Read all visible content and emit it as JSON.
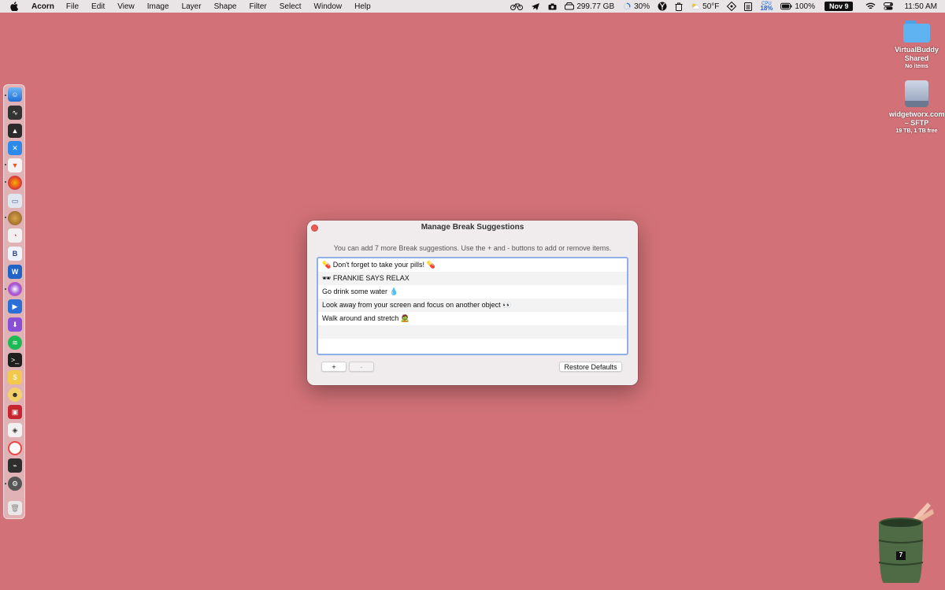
{
  "menubar": {
    "apple_icon": "apple-icon",
    "app_name": "Acorn",
    "menus": [
      "File",
      "Edit",
      "View",
      "Image",
      "Layer",
      "Shape",
      "Filter",
      "Select",
      "Window",
      "Help"
    ],
    "status": {
      "disk": "299.77 GB",
      "progress": "30%",
      "weather": "50°F",
      "cpu_label": "CPU",
      "cpu_value": "18%",
      "battery": "100%",
      "date": "Nov 9",
      "time": "11:50 AM"
    }
  },
  "desktop": {
    "folder": {
      "label": "VirtualBuddy Shared",
      "sub": "No items"
    },
    "drive": {
      "label": "widgetworx.com – SFTP",
      "sub": "19 TB, 1 TB free"
    },
    "trash_badge": "7"
  },
  "dialog": {
    "title": "Manage Break Suggestions",
    "info": "You can add 7 more Break suggestions. Use the + and - buttons to add or remove items.",
    "items": [
      "💊 Don't forget to take your pills! 💊",
      "🕶 FRANKIE SAYS RELAX",
      "Go drink some water 💧",
      "Look away from your screen and focus on another object 👀",
      "Walk around and stretch 🧟"
    ],
    "add_label": "+",
    "remove_label": "-",
    "restore_label": "Restore Defaults"
  },
  "colors": {
    "desktop": "#d27278",
    "accent_border": "#8fb0e6",
    "close": "#ec5a52"
  }
}
